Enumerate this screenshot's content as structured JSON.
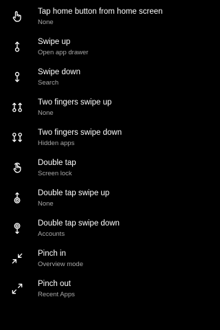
{
  "colors": {
    "background": "#000000",
    "title": "#ffffff",
    "subtitle": "#a8a8a8",
    "icon": "#ffffff"
  },
  "gestures": [
    {
      "icon": "tap-hand-icon",
      "title": "Tap home button from home screen",
      "subtitle": "None"
    },
    {
      "icon": "swipe-up-icon",
      "title": "Swipe up",
      "subtitle": "Open app drawer"
    },
    {
      "icon": "swipe-down-icon",
      "title": "Swipe down",
      "subtitle": "Search"
    },
    {
      "icon": "two-finger-swipe-up-icon",
      "title": "Two fingers swipe up",
      "subtitle": "None"
    },
    {
      "icon": "two-finger-swipe-down-icon",
      "title": "Two fingers swipe down",
      "subtitle": "Hidden apps"
    },
    {
      "icon": "double-tap-icon",
      "title": "Double tap",
      "subtitle": "Screen lock"
    },
    {
      "icon": "double-tap-swipe-up-icon",
      "title": "Double tap swipe up",
      "subtitle": "None"
    },
    {
      "icon": "double-tap-swipe-down-icon",
      "title": "Double tap swipe down",
      "subtitle": "Accounts"
    },
    {
      "icon": "pinch-in-icon",
      "title": "Pinch in",
      "subtitle": "Overview mode"
    },
    {
      "icon": "pinch-out-icon",
      "title": "Pinch out",
      "subtitle": "Recent Apps"
    }
  ]
}
